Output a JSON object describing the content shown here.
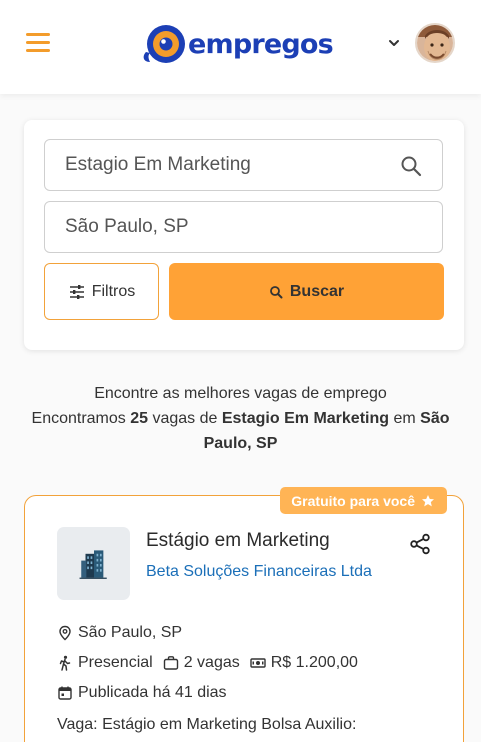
{
  "header": {
    "brand": "empregos",
    "brand_color": "#1c3fb5",
    "accent_color": "#f39c2b",
    "menu_icon": "hamburger-icon",
    "dropdown_icon": "chevron-down-icon"
  },
  "search": {
    "keyword_value": "Estagio Em Marketing",
    "location_value": "São Paulo, SP",
    "filters_label": "Filtros",
    "search_label": "Buscar",
    "search_button_color": "#ffa236"
  },
  "results": {
    "tagline": "Encontre as melhores vagas de emprego",
    "prefix": "Encontramos ",
    "count": "25",
    "middle": " vagas de ",
    "query": "Estagio Em Marketing",
    "connector": " em ",
    "location": "São Paulo, SP"
  },
  "job": {
    "badge": "Gratuito para você",
    "title": "Estágio em Marketing",
    "company": "Beta Soluções Financeiras Ltda",
    "location": "São Paulo, SP",
    "work_mode": "Presencial",
    "openings": "2 vagas",
    "salary": "R$ 1.200,00",
    "published": "Publicada há 41 dias",
    "description_start": "Vaga: Estágio em Marketing Bolsa Auxilio:"
  }
}
